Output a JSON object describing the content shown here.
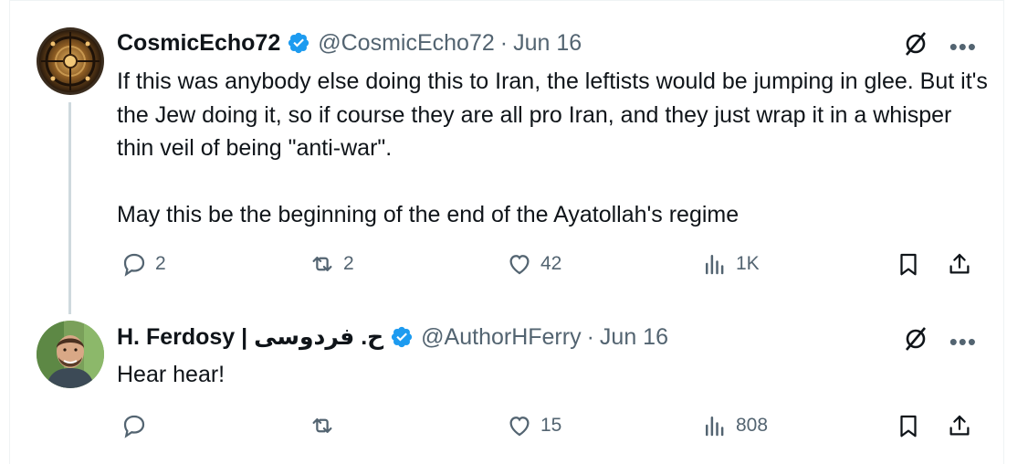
{
  "tweets": [
    {
      "name": "CosmicEcho72",
      "handle": "@CosmicEcho72",
      "separator": "·",
      "date": "Jun 16",
      "text": "If this was anybody else doing this to Iran, the leftists would be jumping in glee. But it's the Jew doing it, so if course they are all pro Iran, and they just wrap it in a whisper thin veil of being \"anti-war\".\n\nMay this be the beginning of the end of the Ayatollah's regime",
      "replies": "2",
      "reposts": "2",
      "likes": "42",
      "views": "1K"
    },
    {
      "name": "H. Ferdosy | ح. فردوسی",
      "handle": "@AuthorHFerry",
      "separator": "·",
      "date": "Jun 16",
      "text": "Hear hear!",
      "replies": "",
      "reposts": "",
      "likes": "15",
      "views": "808"
    }
  ],
  "colors": {
    "verified": "#1d9bf0",
    "muted": "#536471",
    "text": "#0f1419",
    "thread_line": "#cfd9de"
  },
  "icons": [
    "reply-icon",
    "repost-icon",
    "like-icon",
    "views-icon",
    "bookmark-icon",
    "share-icon",
    "grok-icon",
    "more-icon",
    "verified-icon"
  ]
}
